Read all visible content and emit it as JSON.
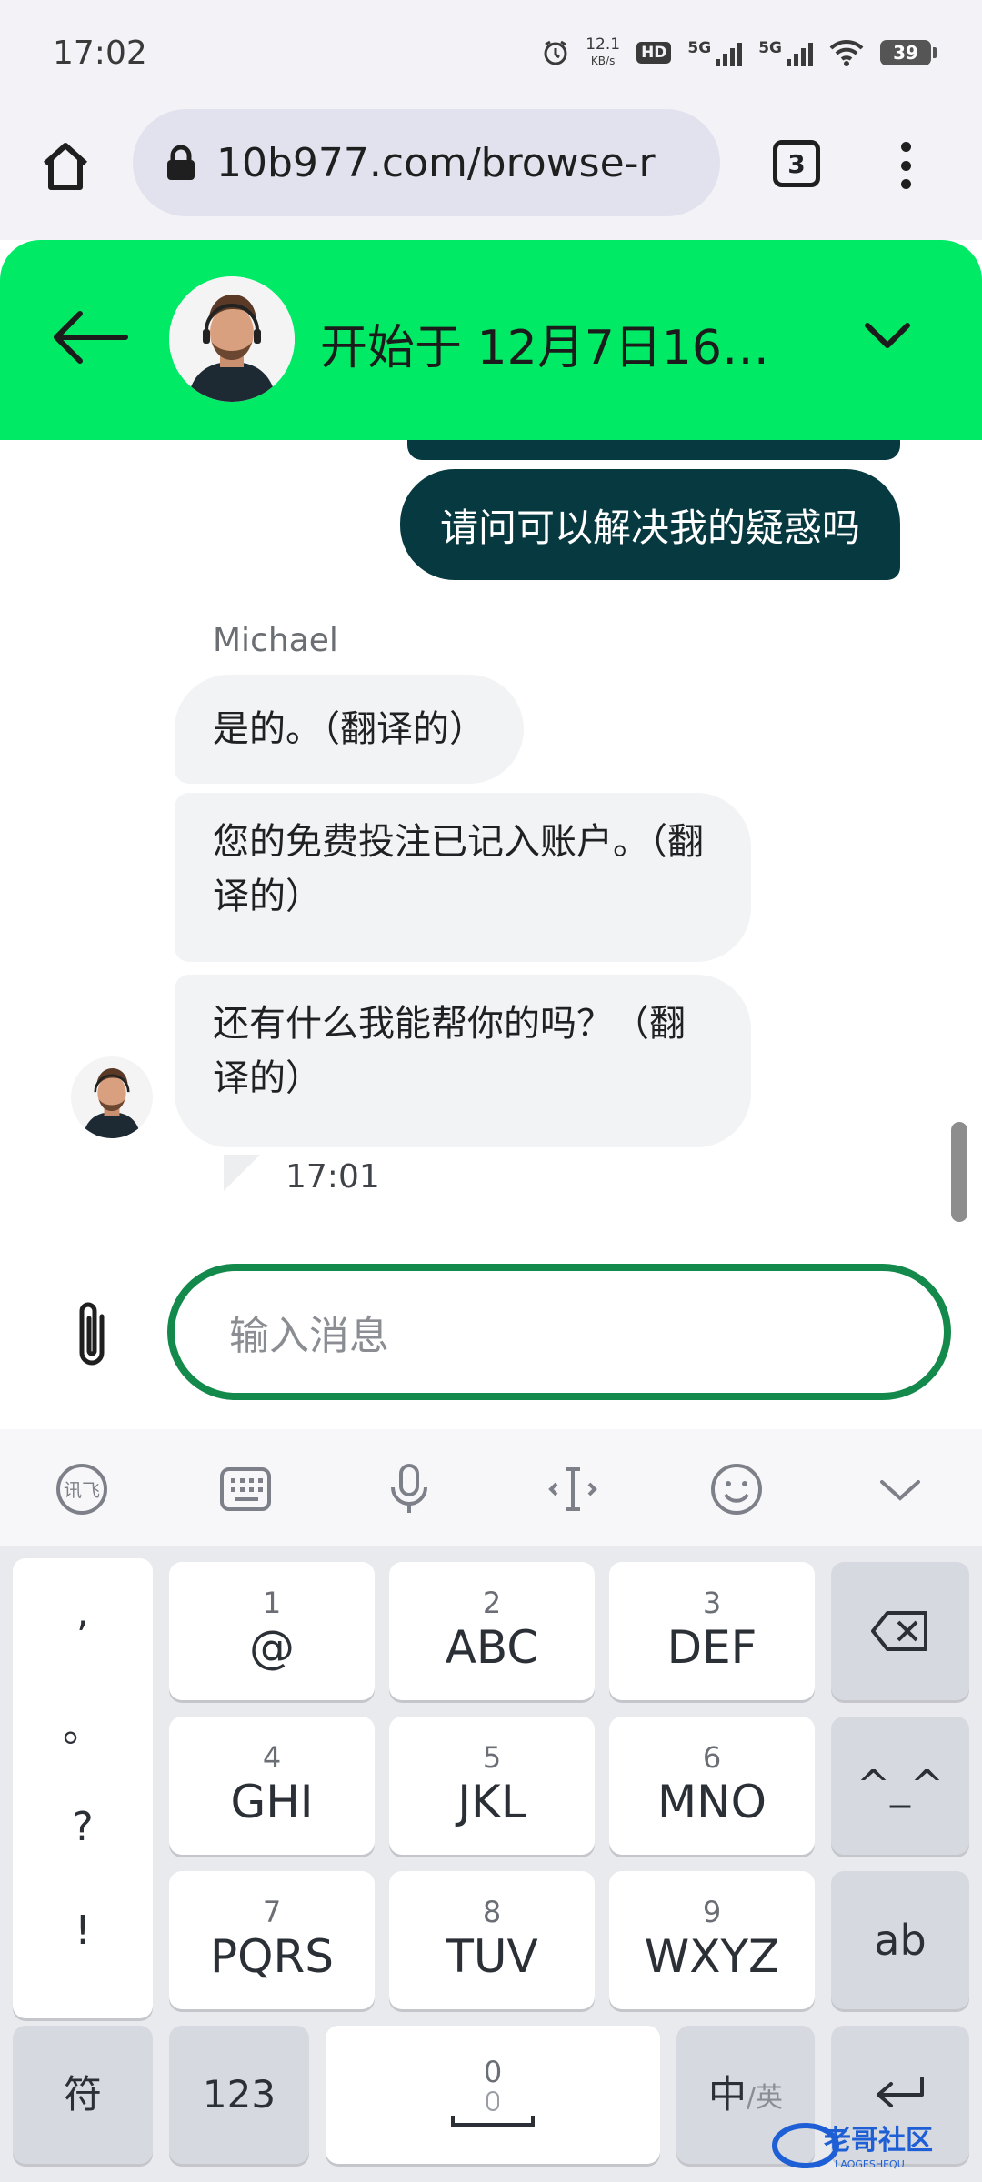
{
  "status_bar": {
    "time": "17:02",
    "net_speed_value": "12.1",
    "net_speed_unit": "KB/s",
    "hd_label": "HD",
    "signal_1": "5G",
    "signal_2": "5G",
    "battery": "39"
  },
  "browser": {
    "url": "10b977.com/browse-r",
    "tab_count": "3"
  },
  "chat": {
    "title": "开始于 12月7日16…",
    "agent_name": "Michael",
    "outgoing_message": "请问可以解决我的疑惑吗",
    "incoming_messages": [
      "是的。（翻译的）",
      "您的免费投注已记入账户。（翻译的）",
      "还有什么我能帮你的吗？（翻译的）"
    ],
    "last_time": "17:01",
    "input_placeholder": "输入消息"
  },
  "keyboard": {
    "punctuation": [
      ",",
      "。",
      "?",
      "!"
    ],
    "keys": [
      {
        "num": "1",
        "main": "@"
      },
      {
        "num": "2",
        "main": "ABC"
      },
      {
        "num": "3",
        "main": "DEF"
      },
      {
        "num": "4",
        "main": "GHI"
      },
      {
        "num": "5",
        "main": "JKL"
      },
      {
        "num": "6",
        "main": "MNO"
      },
      {
        "num": "7",
        "main": "PQRS"
      },
      {
        "num": "8",
        "main": "TUV"
      },
      {
        "num": "9",
        "main": "WXYZ"
      }
    ],
    "emoticon_key": "^_^",
    "ab_key": "ab",
    "symbol_key": "符",
    "numeric_key": "123",
    "space_num": "0",
    "lang_key_main": "中",
    "lang_key_sub": "/英"
  },
  "watermark": {
    "text": "老哥社区",
    "subtext": "LAOGESHEQU"
  },
  "colors": {
    "header_green": "#00ea66",
    "outgoing_bubble": "#073a40",
    "input_border": "#138a4b"
  }
}
